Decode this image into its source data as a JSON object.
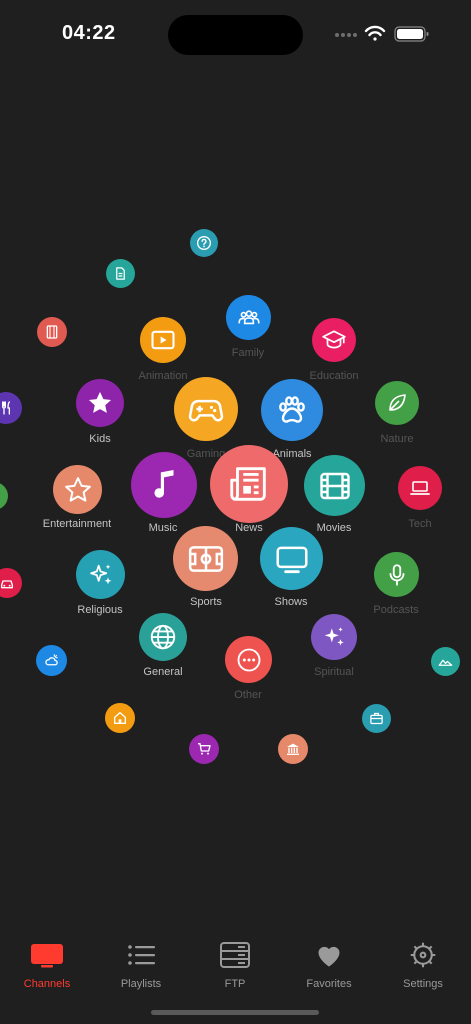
{
  "status_bar": {
    "time": "04:22"
  },
  "categories": [
    {
      "label": "Family",
      "icon": "people-icon",
      "color": "#1e88e5"
    },
    {
      "label": "Animation",
      "icon": "play-icon",
      "color": "#f39c12"
    },
    {
      "label": "Education",
      "icon": "graduation-cap-icon",
      "color": "#e91e63"
    },
    {
      "label": "Kids",
      "icon": "star-icon",
      "color": "#8e24aa"
    },
    {
      "label": "Gaming",
      "icon": "gamepad-icon",
      "color": "#f5a623"
    },
    {
      "label": "Animals",
      "icon": "paw-icon",
      "color": "#2e8be0"
    },
    {
      "label": "Food",
      "icon": "fork-knife-icon",
      "color": "#5e35b1"
    },
    {
      "label": "Nature",
      "icon": "leaf-icon",
      "color": "#43a047"
    },
    {
      "label": "Entertainment",
      "icon": "star-outline-icon",
      "color": "#e6896a"
    },
    {
      "label": "Music",
      "icon": "music-note-icon",
      "color": "#9c27b0"
    },
    {
      "label": "News",
      "icon": "newspaper-icon",
      "color": "#ef6b6b"
    },
    {
      "label": "Movies",
      "icon": "film-icon",
      "color": "#26a69a"
    },
    {
      "label": "Tech",
      "icon": "laptop-icon",
      "color": "#e01e4a"
    },
    {
      "label": "Religious",
      "icon": "sparkles-icon",
      "color": "#26a0b3"
    },
    {
      "label": "Sports",
      "icon": "field-icon",
      "color": "#e58a6e"
    },
    {
      "label": "Shows",
      "icon": "tv-icon",
      "color": "#2aa6c0"
    },
    {
      "label": "Podcasts",
      "icon": "microphone-icon",
      "color": "#43a047"
    },
    {
      "label": "General",
      "icon": "globe-icon",
      "color": "#2aa198"
    },
    {
      "label": "Other",
      "icon": "ellipsis-icon",
      "color": "#ef5350"
    },
    {
      "label": "Spiritual",
      "icon": "sparkles-icon",
      "color": "#7e57c2"
    }
  ],
  "tabs": [
    {
      "label": "Channels",
      "icon": "tv-icon",
      "active": true
    },
    {
      "label": "Playlists",
      "icon": "list-icon",
      "active": false
    },
    {
      "label": "FTP",
      "icon": "server-icon",
      "active": false
    },
    {
      "label": "Favorites",
      "icon": "heart-icon",
      "active": false
    },
    {
      "label": "Settings",
      "icon": "gear-icon",
      "active": false
    }
  ],
  "colors": {
    "accent": "#ff3b30",
    "background": "#1f1f1f",
    "tab_inactive": "#9a9a9a"
  }
}
